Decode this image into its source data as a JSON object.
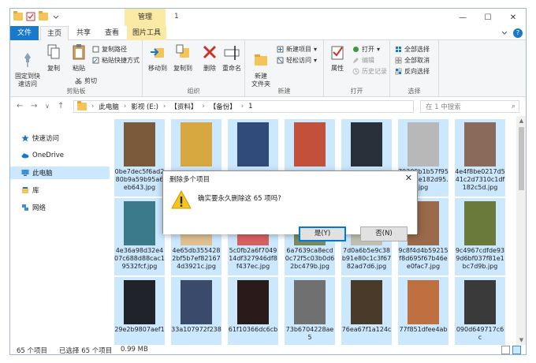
{
  "titlebar": {
    "context_tab": "管理",
    "title": "1",
    "minimize": "—",
    "maximize": "☐",
    "close": "✕"
  },
  "tabs": {
    "file": "文件",
    "home": "主页",
    "share": "共享",
    "view": "查看",
    "picture_tools": "图片工具"
  },
  "ribbon": {
    "clipboard": {
      "label": "剪贴板",
      "pin": "固定到快\n速访问",
      "copy": "复制",
      "paste": "粘贴",
      "copy_path": "复制路径",
      "paste_shortcut": "粘贴快捷方式",
      "cut": "剪切"
    },
    "organize": {
      "label": "组织",
      "move_to": "移动到",
      "copy_to": "复制到",
      "delete": "删除",
      "rename": "重命名"
    },
    "new": {
      "label": "新建",
      "new_folder": "新建\n文件夹",
      "new_item": "新建项目",
      "easy_access": "轻松访问"
    },
    "open": {
      "label": "打开",
      "properties": "属性",
      "open": "打开",
      "edit": "编辑",
      "history": "历史记录"
    },
    "select": {
      "label": "选择",
      "select_all": "全部选择",
      "select_none": "全部取消",
      "invert": "反向选择"
    }
  },
  "address": {
    "back": "←",
    "forward": "→",
    "recent": "∨",
    "up": "↑",
    "crumbs": [
      "此电脑",
      "影视 (E:)",
      "【资料】",
      "【备份】",
      "1"
    ],
    "search_placeholder": "在 1 中搜索"
  },
  "nav": {
    "quick_access": "快速访问",
    "onedrive": "OneDrive",
    "this_pc": "此电脑",
    "libraries": "库",
    "network": "网络"
  },
  "files": [
    {
      "name": "0be7dec5f6ad280b9a59b95a6eb643.jpg",
      "color": "#7a5a3a"
    },
    {
      "name": "",
      "color": "#d8a840"
    },
    {
      "name": "",
      "color": "#304a7a"
    },
    {
      "name": "",
      "color": "#c2503a"
    },
    {
      "name": "",
      "color": "#28303a"
    },
    {
      "name": "79209b1b57f9573063e182d95.jpg",
      "color": "#b8b8b8"
    },
    {
      "name": "4e4f8be0217d541c2d7310c1df182c5d.jpg",
      "color": "#8a6a5a"
    },
    {
      "name": "4e36a98d32e407c688d88cac19532fcf.jpg",
      "color": "#3a7a8a"
    },
    {
      "name": "4e65db3554282bf5b7ef82167 4d3921c.jpg",
      "color": "#e0c090"
    },
    {
      "name": "5c0fb2a6f704914df327946df8f437ec.jpg",
      "color": "#d86060"
    },
    {
      "name": "6a7639ca8ecd0c72f5c03b0d62bc479b.jpg",
      "color": "#7a8a5a"
    },
    {
      "name": "7d0a6b5e9c38b91e80c1c3f6782ad7d6.jpg",
      "color": "#c0c0b0"
    },
    {
      "name": "9c8f4d4b59215f8d695f67b46ee0fac7.jpg",
      "color": "#9a6a4a"
    },
    {
      "name": "9c4967cdfde939d6bf037f81e1bc7d9b.jpg",
      "color": "#6a7a3a"
    },
    {
      "name": "29e2b9807aef1",
      "color": "#20242a"
    },
    {
      "name": "33a107972f238",
      "color": "#3a4a6a"
    },
    {
      "name": "61f10366dc6cb",
      "color": "#2a1a1a"
    },
    {
      "name": "73b6704228ae5",
      "color": "#707070"
    },
    {
      "name": "76ea67f1a124c",
      "color": "#4a3a2a"
    },
    {
      "name": "77f851dfee4ab",
      "color": "#c07040"
    },
    {
      "name": "090d649717c6c",
      "color": "#3a3a3a"
    }
  ],
  "status": {
    "count": "65 个项目",
    "selected": "已选择 65 个项目",
    "size": "0.99 MB"
  },
  "dialog": {
    "title": "删除多个项目",
    "close": "✕",
    "message": "确实要永久删除这 65 项吗?",
    "yes": "是(Y)",
    "no": "否(N)"
  },
  "colors": {
    "accent": "#1979ca",
    "selection": "#cce8ff",
    "context_tab": "#fbe9a6",
    "warning": "#f5c518"
  }
}
